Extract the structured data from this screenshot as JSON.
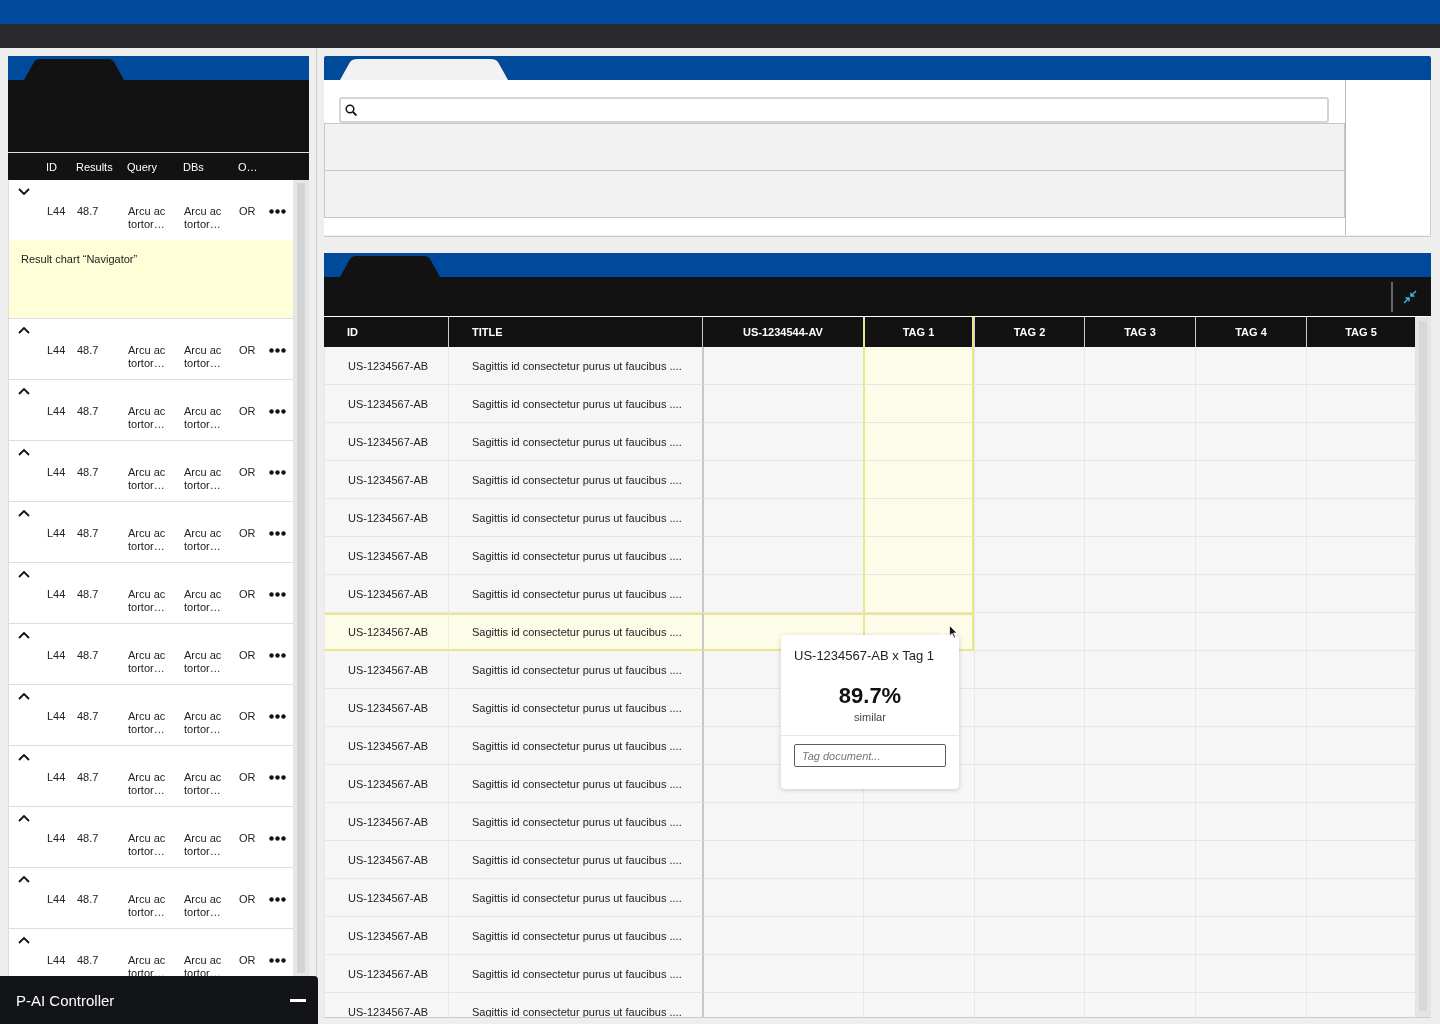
{
  "query_panel": {
    "columns": [
      "ID",
      "Results",
      "Query",
      "DBs",
      "O…"
    ],
    "rows": [
      {
        "id": "L44",
        "results": "48.7",
        "query": "Arcu ac tortor…",
        "dbs": "Arcu ac tortor…",
        "operator": "OR",
        "expanded": true,
        "detail": "Result chart “Navigator”"
      },
      {
        "id": "L44",
        "results": "48.7",
        "query": "Arcu ac tortor…",
        "dbs": "Arcu ac tortor…",
        "operator": "OR",
        "expanded": false
      },
      {
        "id": "L44",
        "results": "48.7",
        "query": "Arcu ac tortor…",
        "dbs": "Arcu ac tortor…",
        "operator": "OR",
        "expanded": false
      },
      {
        "id": "L44",
        "results": "48.7",
        "query": "Arcu ac tortor…",
        "dbs": "Arcu ac tortor…",
        "operator": "OR",
        "expanded": false
      },
      {
        "id": "L44",
        "results": "48.7",
        "query": "Arcu ac tortor…",
        "dbs": "Arcu ac tortor…",
        "operator": "OR",
        "expanded": false
      },
      {
        "id": "L44",
        "results": "48.7",
        "query": "Arcu ac tortor…",
        "dbs": "Arcu ac tortor…",
        "operator": "OR",
        "expanded": false
      },
      {
        "id": "L44",
        "results": "48.7",
        "query": "Arcu ac tortor…",
        "dbs": "Arcu ac tortor…",
        "operator": "OR",
        "expanded": false
      },
      {
        "id": "L44",
        "results": "48.7",
        "query": "Arcu ac tortor…",
        "dbs": "Arcu ac tortor…",
        "operator": "OR",
        "expanded": false
      },
      {
        "id": "L44",
        "results": "48.7",
        "query": "Arcu ac tortor…",
        "dbs": "Arcu ac tortor…",
        "operator": "OR",
        "expanded": false
      },
      {
        "id": "L44",
        "results": "48.7",
        "query": "Arcu ac tortor…",
        "dbs": "Arcu ac tortor…",
        "operator": "OR",
        "expanded": false
      },
      {
        "id": "L44",
        "results": "48.7",
        "query": "Arcu ac tortor…",
        "dbs": "Arcu ac tortor…",
        "operator": "OR",
        "expanded": false
      },
      {
        "id": "L44",
        "results": "48.7",
        "query": "Arcu ac tortor…",
        "dbs": "Arcu ac tortor…",
        "operator": "OR",
        "expanded": false
      }
    ]
  },
  "results_table": {
    "columns": [
      {
        "label": "ID",
        "selected": false
      },
      {
        "label": "TITLE",
        "selected": false
      },
      {
        "label": "US-1234544-AV",
        "selected": false
      },
      {
        "label": "TAG 1",
        "selected": true
      },
      {
        "label": "TAG 2",
        "selected": false
      },
      {
        "label": "TAG 3",
        "selected": false
      },
      {
        "label": "TAG 4",
        "selected": false
      },
      {
        "label": "TAG 5",
        "selected": false
      }
    ],
    "rows": [
      {
        "id": "US-1234567-AB",
        "title": "Sagittis id consectetur purus ut faucibus ....",
        "selected": false
      },
      {
        "id": "US-1234567-AB",
        "title": "Sagittis id consectetur purus ut faucibus ....",
        "selected": false
      },
      {
        "id": "US-1234567-AB",
        "title": "Sagittis id consectetur purus ut faucibus ....",
        "selected": false
      },
      {
        "id": "US-1234567-AB",
        "title": "Sagittis id consectetur purus ut faucibus ....",
        "selected": false
      },
      {
        "id": "US-1234567-AB",
        "title": "Sagittis id consectetur purus ut faucibus ....",
        "selected": false
      },
      {
        "id": "US-1234567-AB",
        "title": "Sagittis id consectetur purus ut faucibus ....",
        "selected": false
      },
      {
        "id": "US-1234567-AB",
        "title": "Sagittis id consectetur purus ut faucibus ....",
        "selected": false
      },
      {
        "id": "US-1234567-AB",
        "title": "Sagittis id consectetur purus ut faucibus ....",
        "selected": true
      },
      {
        "id": "US-1234567-AB",
        "title": "Sagittis id consectetur purus ut faucibus ....",
        "selected": false
      },
      {
        "id": "US-1234567-AB",
        "title": "Sagittis id consectetur purus ut faucibus ....",
        "selected": false
      },
      {
        "id": "US-1234567-AB",
        "title": "Sagittis id consectetur purus ut faucibus ....",
        "selected": false
      },
      {
        "id": "US-1234567-AB",
        "title": "Sagittis id consectetur purus ut faucibus ....",
        "selected": false
      },
      {
        "id": "US-1234567-AB",
        "title": "Sagittis id consectetur purus ut faucibus ....",
        "selected": false
      },
      {
        "id": "US-1234567-AB",
        "title": "Sagittis id consectetur purus ut faucibus ....",
        "selected": false
      },
      {
        "id": "US-1234567-AB",
        "title": "Sagittis id consectetur purus ut faucibus ....",
        "selected": false
      },
      {
        "id": "US-1234567-AB",
        "title": "Sagittis id consectetur purus ut faucibus ....",
        "selected": false
      },
      {
        "id": "US-1234567-AB",
        "title": "Sagittis id consectetur purus ut faucibus ....",
        "selected": false
      },
      {
        "id": "US-1234567-AB",
        "title": "Sagittis id consectetur purus ut faucibus ....",
        "selected": false
      }
    ]
  },
  "popover": {
    "title": "US-1234567-AB x Tag 1",
    "value": "89.7%",
    "caption": "similar",
    "input": {
      "placeholder": "Tag document..."
    }
  },
  "controller": {
    "title": "P-AI Controller"
  }
}
